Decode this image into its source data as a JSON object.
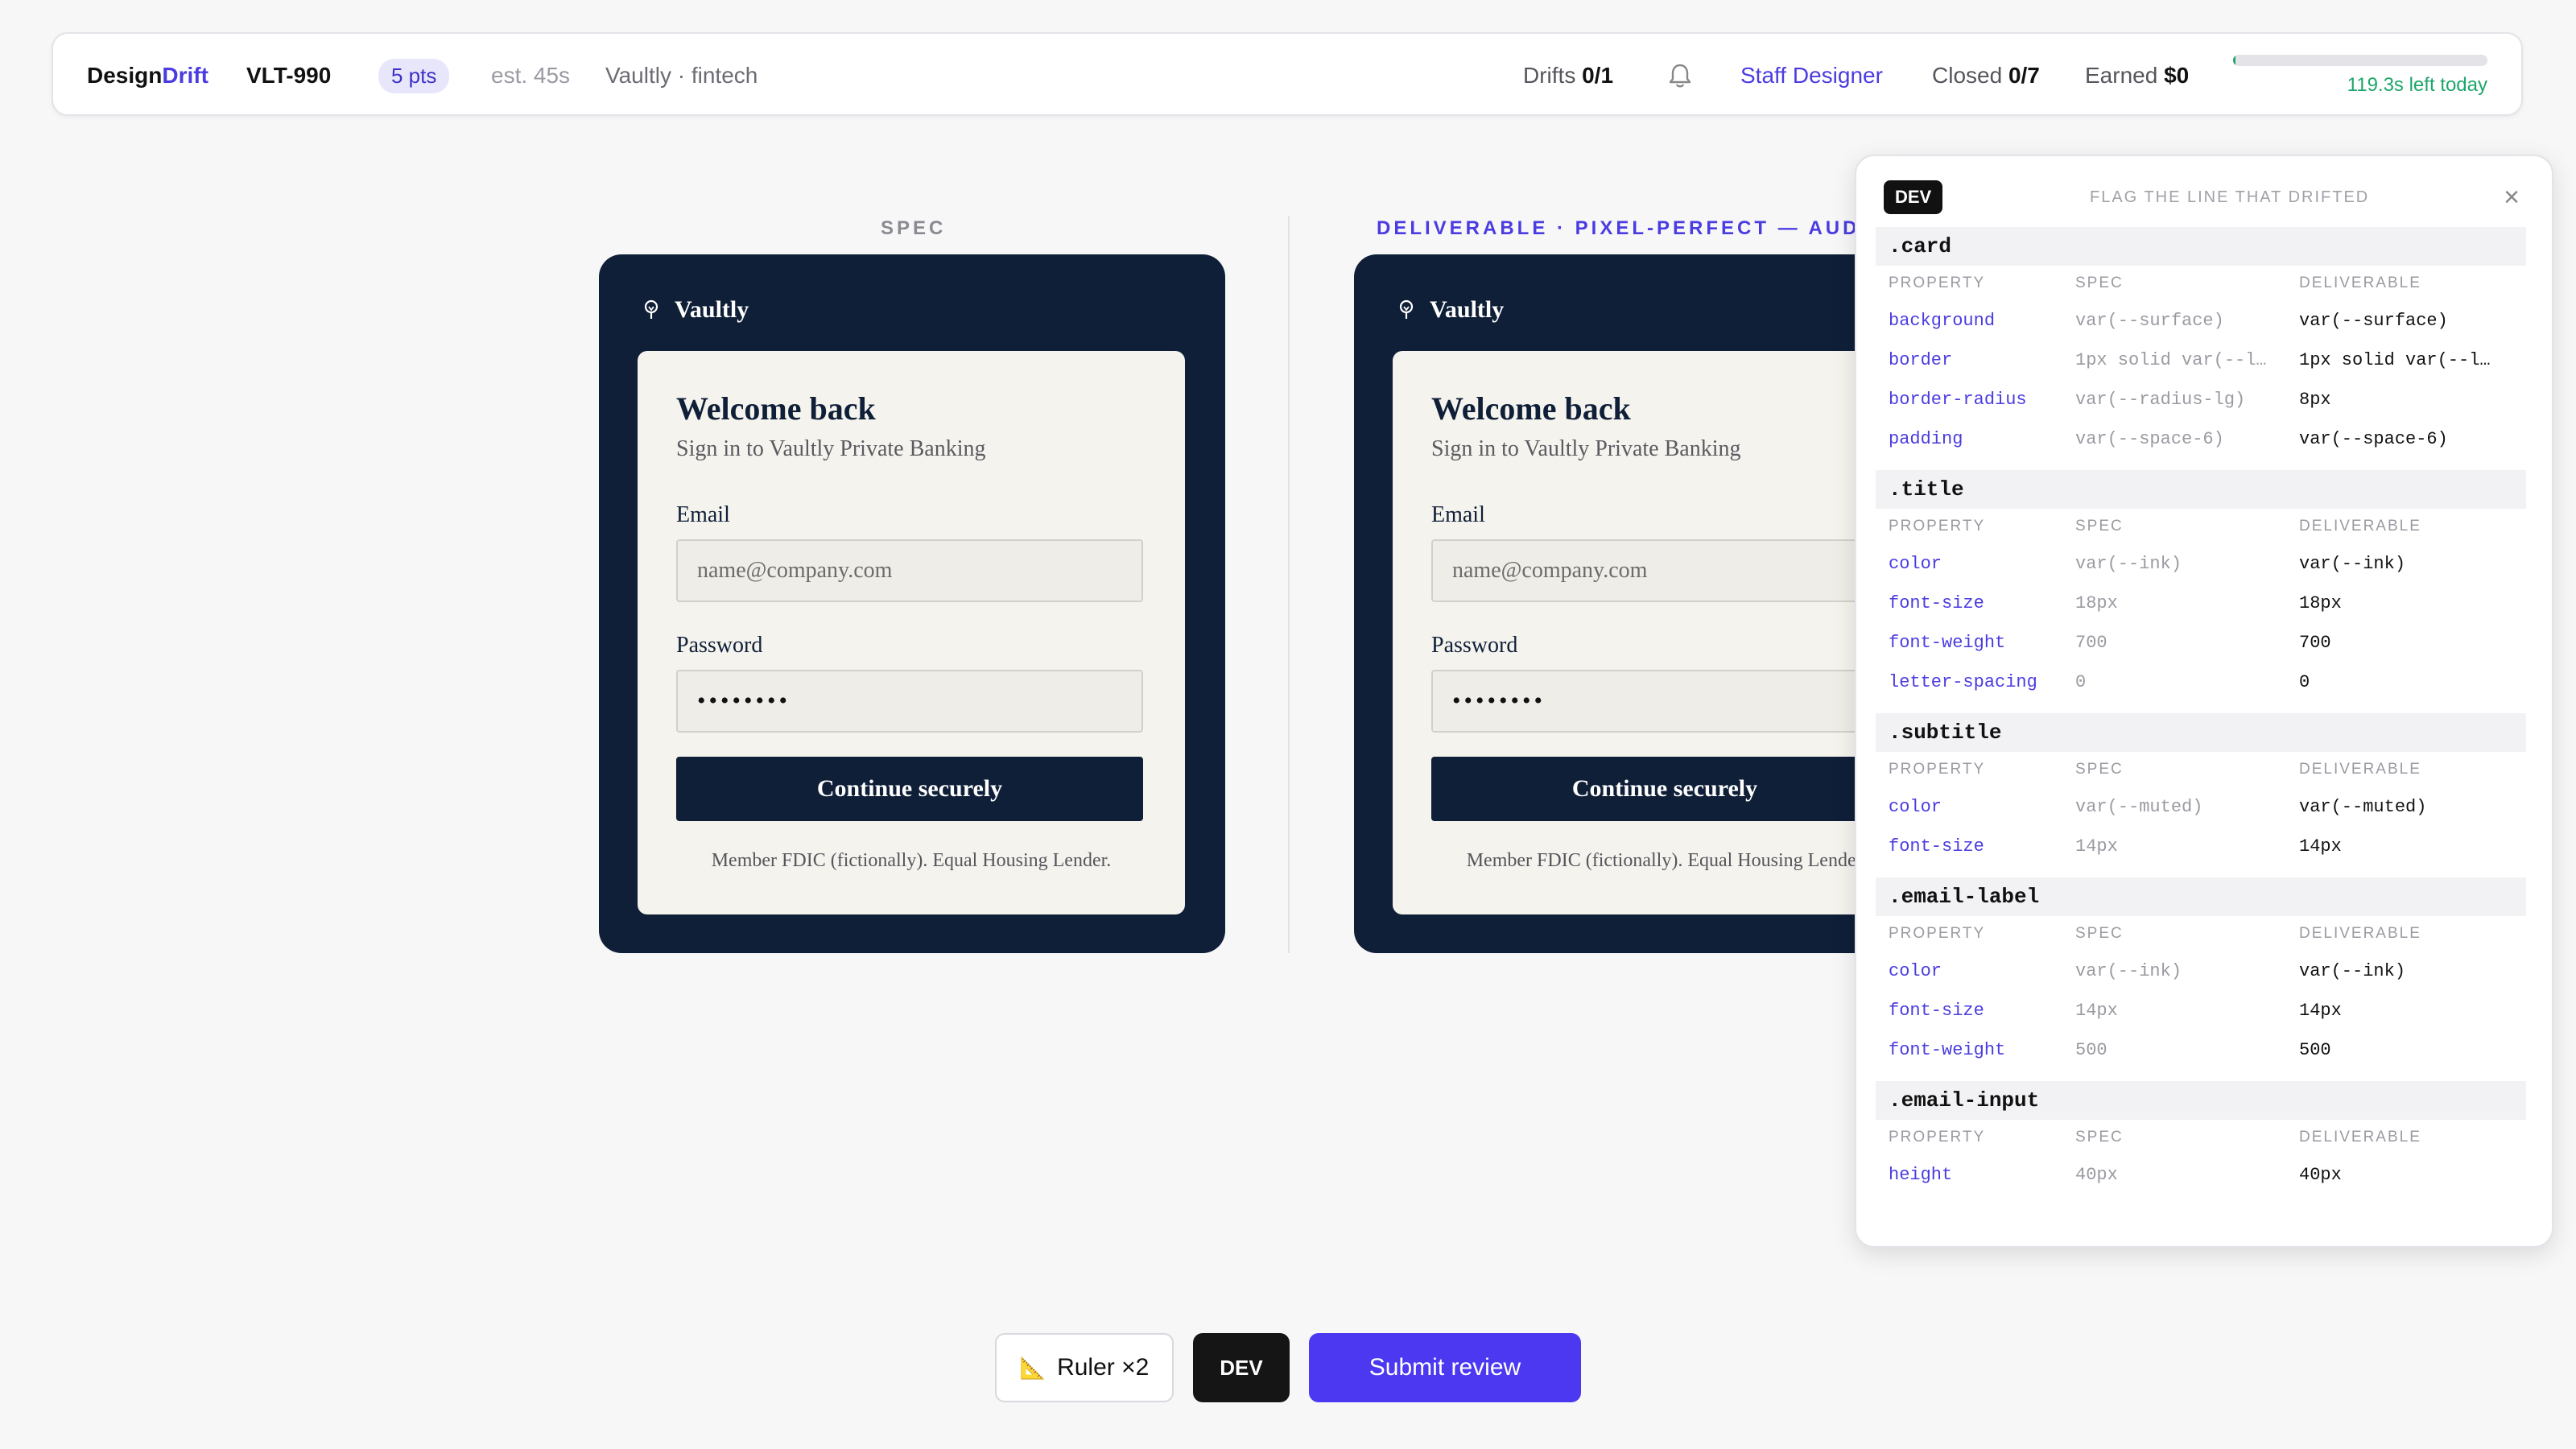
{
  "topbar": {
    "brand_prefix": "Design",
    "brand_accent": "Drift",
    "ticket": "VLT-990",
    "points": "5 pts",
    "estimate": "est. 45s",
    "project": "Vaultly · fintech",
    "drifts_label": "Drifts",
    "drifts_value": "0/1",
    "role": "Staff Designer",
    "closed_label": "Closed",
    "closed_value": "0/7",
    "earned_label": "Earned",
    "earned_value": "$0",
    "time_left": "119.3s left today",
    "time_left_fraction": 0.01
  },
  "spec": {
    "column_label": "SPEC",
    "logo": "Vaultly",
    "title": "Welcome back",
    "subtitle": "Sign in to Vaultly Private Banking",
    "email_label": "Email",
    "email_placeholder": "name@company.com",
    "password_label": "Password",
    "password_value": "••••••••",
    "button": "Continue securely",
    "footer": "Member FDIC (fictionally). Equal Housing Lender."
  },
  "deliverable": {
    "column_label": "DELIVERABLE · PIXEL-PERFECT — AUDIT T",
    "logo": "Vaultly",
    "title": "Welcome back",
    "subtitle": "Sign in to Vaultly Private Banking",
    "email_label": "Email",
    "email_placeholder": "name@company.com",
    "password_label": "Password",
    "password_value": "••••••••",
    "button": "Continue securely",
    "footer": "Member FDIC (fictionally). Equal Housing Lender."
  },
  "dev_panel": {
    "badge": "DEV",
    "hint": "FLAG THE LINE THAT DRIFTED",
    "close": "×",
    "col_property": "PROPERTY",
    "col_spec": "SPEC",
    "col_deliverable": "DELIVERABLE",
    "sections": [
      {
        "selector": ".card",
        "rows": [
          {
            "property": "background",
            "spec": "var(--surface)",
            "deliverable": "var(--surface)"
          },
          {
            "property": "border",
            "spec": "1px solid var(--l…",
            "deliverable": "1px solid var(--l…"
          },
          {
            "property": "border-radius",
            "spec": "var(--radius-lg)",
            "deliverable": "8px"
          },
          {
            "property": "padding",
            "spec": "var(--space-6)",
            "deliverable": "var(--space-6)"
          }
        ]
      },
      {
        "selector": ".title",
        "rows": [
          {
            "property": "color",
            "spec": "var(--ink)",
            "deliverable": "var(--ink)"
          },
          {
            "property": "font-size",
            "spec": "18px",
            "deliverable": "18px"
          },
          {
            "property": "font-weight",
            "spec": "700",
            "deliverable": "700"
          },
          {
            "property": "letter-spacing",
            "spec": "0",
            "deliverable": "0"
          }
        ]
      },
      {
        "selector": ".subtitle",
        "rows": [
          {
            "property": "color",
            "spec": "var(--muted)",
            "deliverable": "var(--muted)"
          },
          {
            "property": "font-size",
            "spec": "14px",
            "deliverable": "14px"
          }
        ]
      },
      {
        "selector": ".email-label",
        "rows": [
          {
            "property": "color",
            "spec": "var(--ink)",
            "deliverable": "var(--ink)"
          },
          {
            "property": "font-size",
            "spec": "14px",
            "deliverable": "14px"
          },
          {
            "property": "font-weight",
            "spec": "500",
            "deliverable": "500"
          }
        ]
      },
      {
        "selector": ".email-input",
        "rows": [
          {
            "property": "height",
            "spec": "40px",
            "deliverable": "40px"
          }
        ]
      }
    ]
  },
  "toolbar": {
    "ruler_icon": "📐",
    "ruler_label": "Ruler ×2",
    "dev_label": "DEV",
    "submit_label": "Submit review"
  },
  "colors": {
    "accent": "#4a3ce0",
    "navy": "#0f1f38",
    "success": "#1ea66a",
    "submit": "#4b38f0"
  }
}
